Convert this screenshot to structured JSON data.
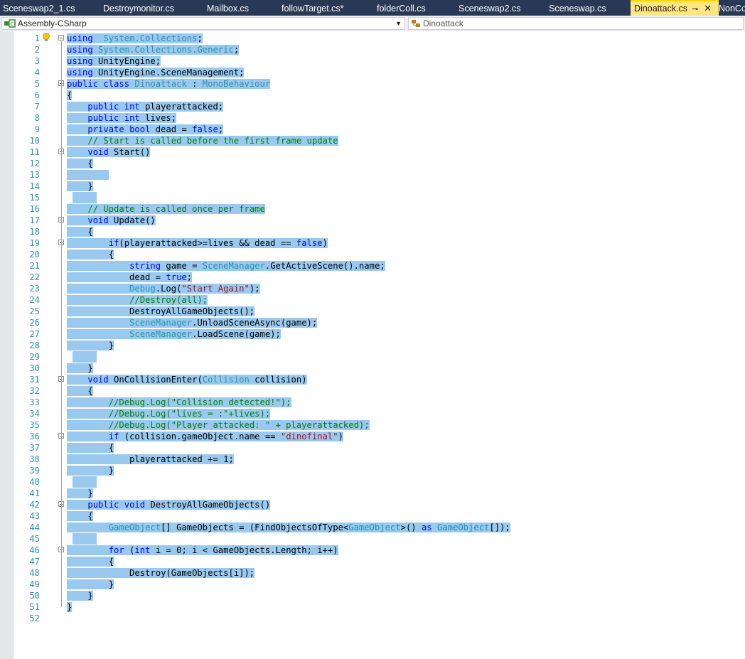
{
  "tabs": [
    {
      "label": "Sceneswap2_1.cs",
      "active": false
    },
    {
      "label": "Destroymonitor.cs",
      "active": false
    },
    {
      "label": "Mailbox.cs",
      "active": false
    },
    {
      "label": "followTarget.cs*",
      "active": false
    },
    {
      "label": "folderColl.cs",
      "active": false
    },
    {
      "label": "Sceneswap2.cs",
      "active": false
    },
    {
      "label": "Sceneswap.cs",
      "active": false
    },
    {
      "label": "Dinoattack.cs",
      "active": true
    },
    {
      "label": "NonCo",
      "active": false
    }
  ],
  "tab_icons": {
    "pin": "⊸",
    "close": "✕"
  },
  "navbar": {
    "project": "Assembly-CSharp",
    "member": "Dinoattack"
  },
  "colors": {
    "tab_strip": "#293955",
    "active_tab": "#ffe680",
    "selection": "#99c9ef",
    "line_numbers": "#2b91af",
    "keyword": "#0000ff",
    "type": "#2b91af",
    "comment": "#008000",
    "string": "#a31515"
  },
  "code_lines": [
    {
      "n": "1",
      "fold": true,
      "tokens": [
        [
          "kw",
          "using"
        ],
        [
          "",
          "  "
        ],
        [
          "ty",
          "System.Collections"
        ],
        [
          "",
          ";"
        ]
      ]
    },
    {
      "n": "2",
      "fold": false,
      "tokens": [
        [
          "kw",
          "using"
        ],
        [
          "",
          " "
        ],
        [
          "ty",
          "System.Collections.Generic"
        ],
        [
          "",
          ";"
        ]
      ]
    },
    {
      "n": "3",
      "fold": false,
      "tokens": [
        [
          "kw",
          "using"
        ],
        [
          "",
          " UnityEngine;"
        ]
      ]
    },
    {
      "n": "4",
      "fold": false,
      "tokens": [
        [
          "kw",
          "using"
        ],
        [
          "",
          " UnityEngine.SceneManagement;"
        ]
      ]
    },
    {
      "n": "5",
      "fold": true,
      "tokens": [
        [
          "kw",
          "public"
        ],
        [
          "",
          " "
        ],
        [
          "kw",
          "class"
        ],
        [
          "",
          " "
        ],
        [
          "ty",
          "Dinoattack"
        ],
        [
          "",
          " : "
        ],
        [
          "ty",
          "MonoBehaviour"
        ]
      ]
    },
    {
      "n": "6",
      "fold": false,
      "tokens": [
        [
          "",
          "{"
        ]
      ]
    },
    {
      "n": "7",
      "fold": false,
      "tokens": [
        [
          "",
          "    "
        ],
        [
          "kw",
          "public"
        ],
        [
          "",
          " "
        ],
        [
          "kw",
          "int"
        ],
        [
          "",
          " playerattacked;"
        ]
      ]
    },
    {
      "n": "8",
      "fold": false,
      "tokens": [
        [
          "",
          "    "
        ],
        [
          "kw",
          "public"
        ],
        [
          "",
          " "
        ],
        [
          "kw",
          "int"
        ],
        [
          "",
          " lives;"
        ]
      ]
    },
    {
      "n": "9",
      "fold": false,
      "tokens": [
        [
          "",
          "    "
        ],
        [
          "kw",
          "private"
        ],
        [
          "",
          " "
        ],
        [
          "kw",
          "bool"
        ],
        [
          "",
          " dead = "
        ],
        [
          "kw",
          "false"
        ],
        [
          "",
          ";"
        ]
      ]
    },
    {
      "n": "10",
      "fold": false,
      "tokens": [
        [
          "",
          "    "
        ],
        [
          "cm",
          "// Start is called before the first frame update"
        ]
      ]
    },
    {
      "n": "11",
      "fold": true,
      "tokens": [
        [
          "",
          "    "
        ],
        [
          "kw",
          "void"
        ],
        [
          "",
          " Start()"
        ]
      ]
    },
    {
      "n": "12",
      "fold": false,
      "tokens": [
        [
          "",
          "    {"
        ]
      ]
    },
    {
      "n": "13",
      "fold": false,
      "tokens": [
        [
          "",
          "        "
        ]
      ]
    },
    {
      "n": "14",
      "fold": false,
      "tokens": [
        [
          "",
          "    }"
        ]
      ]
    },
    {
      "n": "15",
      "fold": false,
      "tokens": [
        [
          "",
          ""
        ]
      ]
    },
    {
      "n": "16",
      "fold": false,
      "tokens": [
        [
          "",
          "    "
        ],
        [
          "cm",
          "// Update is called once per frame"
        ]
      ]
    },
    {
      "n": "17",
      "fold": true,
      "tokens": [
        [
          "",
          "    "
        ],
        [
          "kw",
          "void"
        ],
        [
          "",
          " Update()"
        ]
      ]
    },
    {
      "n": "18",
      "fold": false,
      "tokens": [
        [
          "",
          "    {"
        ]
      ]
    },
    {
      "n": "19",
      "fold": true,
      "tokens": [
        [
          "",
          "        "
        ],
        [
          "kw",
          "if"
        ],
        [
          "",
          "(playerattacked>=lives && dead == "
        ],
        [
          "kw",
          "false"
        ],
        [
          "",
          ")"
        ]
      ]
    },
    {
      "n": "20",
      "fold": false,
      "tokens": [
        [
          "",
          "        {"
        ]
      ]
    },
    {
      "n": "21",
      "fold": false,
      "tokens": [
        [
          "",
          "            "
        ],
        [
          "kw",
          "string"
        ],
        [
          "",
          " game = "
        ],
        [
          "ty",
          "SceneManager"
        ],
        [
          "",
          ".GetActiveScene().name;"
        ]
      ]
    },
    {
      "n": "22",
      "fold": false,
      "tokens": [
        [
          "",
          "            dead = "
        ],
        [
          "kw",
          "true"
        ],
        [
          "",
          ";"
        ]
      ]
    },
    {
      "n": "23",
      "fold": false,
      "tokens": [
        [
          "",
          "            "
        ],
        [
          "ty",
          "Debug"
        ],
        [
          "",
          ".Log("
        ],
        [
          "st",
          "\"Start Again\""
        ],
        [
          "",
          ");"
        ]
      ]
    },
    {
      "n": "24",
      "fold": false,
      "tokens": [
        [
          "",
          "            "
        ],
        [
          "cm",
          "//Destroy(all);"
        ]
      ]
    },
    {
      "n": "25",
      "fold": false,
      "tokens": [
        [
          "",
          "            DestroyAllGameObjects();"
        ]
      ]
    },
    {
      "n": "26",
      "fold": false,
      "tokens": [
        [
          "",
          "            "
        ],
        [
          "ty",
          "SceneManager"
        ],
        [
          "",
          ".UnloadSceneAsync(game);"
        ]
      ]
    },
    {
      "n": "27",
      "fold": false,
      "tokens": [
        [
          "",
          "            "
        ],
        [
          "ty",
          "SceneManager"
        ],
        [
          "",
          ".LoadScene(game);"
        ]
      ]
    },
    {
      "n": "28",
      "fold": false,
      "tokens": [
        [
          "",
          "        }"
        ]
      ]
    },
    {
      "n": "29",
      "fold": false,
      "tokens": [
        [
          "",
          ""
        ]
      ]
    },
    {
      "n": "30",
      "fold": false,
      "tokens": [
        [
          "",
          "    }"
        ]
      ]
    },
    {
      "n": "31",
      "fold": true,
      "tokens": [
        [
          "",
          "    "
        ],
        [
          "kw",
          "void"
        ],
        [
          "",
          " OnCollisionEnter("
        ],
        [
          "ty",
          "Collision"
        ],
        [
          "",
          " collision)"
        ]
      ]
    },
    {
      "n": "32",
      "fold": false,
      "tokens": [
        [
          "",
          "    {"
        ]
      ]
    },
    {
      "n": "33",
      "fold": false,
      "tokens": [
        [
          "",
          "        "
        ],
        [
          "cm",
          "//Debug.Log(\"Collision detected!\");"
        ]
      ]
    },
    {
      "n": "34",
      "fold": false,
      "tokens": [
        [
          "",
          "        "
        ],
        [
          "cm",
          "//Debug.Log(\"lives = :\"+lives);"
        ]
      ]
    },
    {
      "n": "35",
      "fold": false,
      "tokens": [
        [
          "",
          "        "
        ],
        [
          "cm",
          "//Debug.Log(\"Player attacked: \" + playerattacked);"
        ]
      ]
    },
    {
      "n": "36",
      "fold": true,
      "tokens": [
        [
          "",
          "        "
        ],
        [
          "kw",
          "if"
        ],
        [
          "",
          " (collision.gameObject.name == "
        ],
        [
          "st",
          "\"dinofinal\""
        ],
        [
          "",
          ")"
        ]
      ]
    },
    {
      "n": "37",
      "fold": false,
      "tokens": [
        [
          "",
          "        {"
        ]
      ]
    },
    {
      "n": "38",
      "fold": false,
      "tokens": [
        [
          "",
          "            playerattacked += 1;"
        ]
      ]
    },
    {
      "n": "39",
      "fold": false,
      "tokens": [
        [
          "",
          "        }"
        ]
      ]
    },
    {
      "n": "40",
      "fold": false,
      "tokens": [
        [
          "",
          ""
        ]
      ]
    },
    {
      "n": "41",
      "fold": false,
      "tokens": [
        [
          "",
          "    }"
        ]
      ]
    },
    {
      "n": "42",
      "fold": true,
      "tokens": [
        [
          "",
          "    "
        ],
        [
          "kw",
          "public"
        ],
        [
          "",
          " "
        ],
        [
          "kw",
          "void"
        ],
        [
          "",
          " DestroyAllGameObjects()"
        ]
      ]
    },
    {
      "n": "43",
      "fold": false,
      "tokens": [
        [
          "",
          "    {"
        ]
      ]
    },
    {
      "n": "44",
      "fold": false,
      "tokens": [
        [
          "",
          "        "
        ],
        [
          "ty",
          "GameObject"
        ],
        [
          "",
          "[] GameObjects = (FindObjectsOfType<"
        ],
        [
          "ty",
          "GameObject"
        ],
        [
          "",
          ">() "
        ],
        [
          "kw",
          "as"
        ],
        [
          "",
          " "
        ],
        [
          "ty",
          "GameObject"
        ],
        [
          "",
          "[]);"
        ]
      ]
    },
    {
      "n": "45",
      "fold": false,
      "tokens": [
        [
          "",
          ""
        ]
      ]
    },
    {
      "n": "46",
      "fold": true,
      "tokens": [
        [
          "",
          "        "
        ],
        [
          "kw",
          "for"
        ],
        [
          "",
          " ("
        ],
        [
          "kw",
          "int"
        ],
        [
          "",
          " i = 0; i < GameObjects.Length; i++)"
        ]
      ]
    },
    {
      "n": "47",
      "fold": false,
      "tokens": [
        [
          "",
          "        {"
        ]
      ]
    },
    {
      "n": "48",
      "fold": false,
      "tokens": [
        [
          "",
          "            Destroy(GameObjects[i]);"
        ]
      ]
    },
    {
      "n": "49",
      "fold": false,
      "tokens": [
        [
          "",
          "        }"
        ]
      ]
    },
    {
      "n": "50",
      "fold": false,
      "tokens": [
        [
          "",
          "    }"
        ]
      ]
    },
    {
      "n": "51",
      "fold": false,
      "tokens": [
        [
          "",
          "}"
        ]
      ]
    },
    {
      "n": "52",
      "fold": false,
      "tokens": []
    }
  ]
}
